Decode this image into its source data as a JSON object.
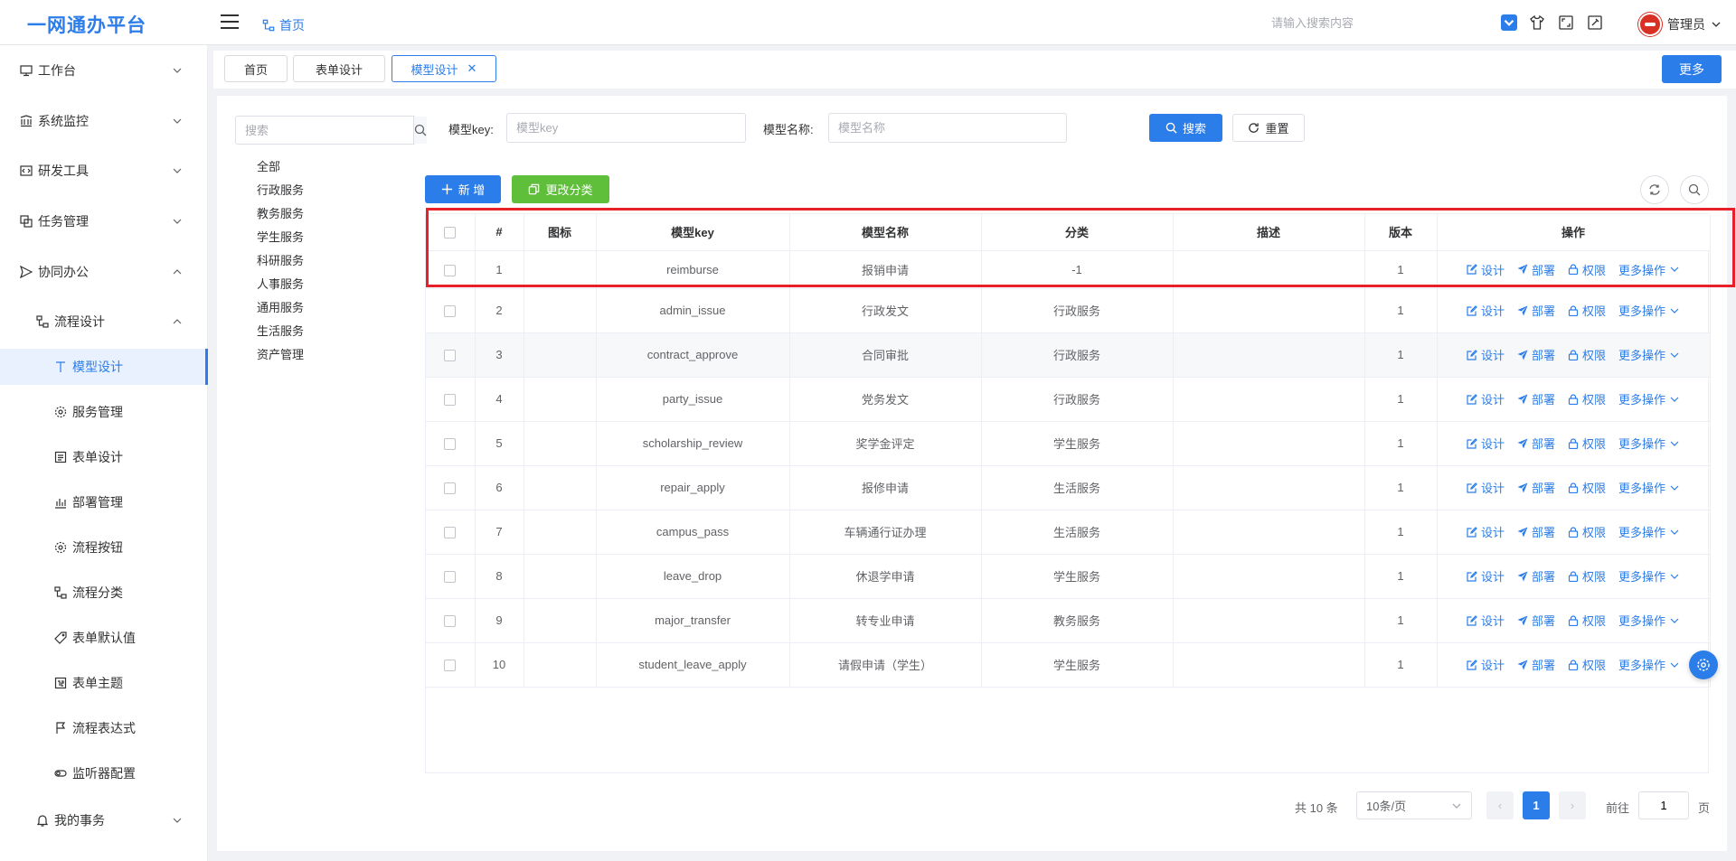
{
  "app": {
    "title": "一网通办平台"
  },
  "header": {
    "breadcrumb": "首页",
    "search_placeholder": "请输入搜索内容",
    "user_name": "管理员",
    "icons": [
      "checkbox-icon",
      "shirt-icon",
      "fullscreen-icon",
      "settings-tool-icon"
    ]
  },
  "sidebar": {
    "items": [
      {
        "label": "工作台",
        "icon": "monitor-icon",
        "level": 1,
        "expanded": false
      },
      {
        "label": "系统监控",
        "icon": "monitor-chart-icon",
        "level": 1,
        "expanded": false
      },
      {
        "label": "研发工具",
        "icon": "code-icon",
        "level": 1,
        "expanded": false
      },
      {
        "label": "任务管理",
        "icon": "task-icon",
        "level": 1,
        "expanded": false
      },
      {
        "label": "协同办公",
        "icon": "send-icon",
        "level": 1,
        "expanded": true
      },
      {
        "label": "流程设计",
        "icon": "flow-icon",
        "level": 2,
        "expanded": true
      },
      {
        "label": "模型设计",
        "icon": "model-icon",
        "level": 3,
        "active": true
      },
      {
        "label": "服务管理",
        "icon": "gear-icon",
        "level": 3
      },
      {
        "label": "表单设计",
        "icon": "form-icon",
        "level": 3
      },
      {
        "label": "部署管理",
        "icon": "bar-chart-icon",
        "level": 3
      },
      {
        "label": "流程按钮",
        "icon": "gear-icon",
        "level": 3
      },
      {
        "label": "流程分类",
        "icon": "flow-icon",
        "level": 3
      },
      {
        "label": "表单默认值",
        "icon": "tag-icon",
        "level": 3
      },
      {
        "label": "表单主题",
        "icon": "theme-icon",
        "level": 3
      },
      {
        "label": "流程表达式",
        "icon": "flag-icon",
        "level": 3
      },
      {
        "label": "监听器配置",
        "icon": "toggle-icon",
        "level": 3
      },
      {
        "label": "我的事务",
        "icon": "bell-icon",
        "level": 2,
        "expanded": false
      }
    ]
  },
  "tabs": [
    {
      "label": "首页"
    },
    {
      "label": "表单设计"
    },
    {
      "label": "模型设计",
      "active": true,
      "closable": true
    }
  ],
  "more_button": "更多",
  "tree": {
    "search_placeholder": "搜索",
    "categories": [
      "全部",
      "行政服务",
      "教务服务",
      "学生服务",
      "科研服务",
      "人事服务",
      "通用服务",
      "生活服务",
      "资产管理"
    ]
  },
  "filters": {
    "key_label": "模型key:",
    "key_placeholder": "模型key",
    "name_label": "模型名称:",
    "name_placeholder": "模型名称",
    "search_button": "搜索",
    "reset_button": "重置"
  },
  "toolbar": {
    "add_button": "新 增",
    "change_category_button": "更改分类"
  },
  "table": {
    "columns": [
      "#",
      "图标",
      "模型key",
      "模型名称",
      "分类",
      "描述",
      "版本",
      "操作"
    ],
    "op_labels": {
      "design": "设计",
      "deploy": "部署",
      "permission": "权限",
      "more": "更多操作"
    },
    "rows": [
      {
        "index": "1",
        "key": "reimburse",
        "name": "报销申请",
        "category": "-1",
        "desc": "",
        "version": "1"
      },
      {
        "index": "2",
        "key": "admin_issue",
        "name": "行政发文",
        "category": "行政服务",
        "desc": "",
        "version": "1"
      },
      {
        "index": "3",
        "key": "contract_approve",
        "name": "合同审批",
        "category": "行政服务",
        "desc": "",
        "version": "1"
      },
      {
        "index": "4",
        "key": "party_issue",
        "name": "党务发文",
        "category": "行政服务",
        "desc": "",
        "version": "1"
      },
      {
        "index": "5",
        "key": "scholarship_review",
        "name": "奖学金评定",
        "category": "学生服务",
        "desc": "",
        "version": "1"
      },
      {
        "index": "6",
        "key": "repair_apply",
        "name": "报修申请",
        "category": "生活服务",
        "desc": "",
        "version": "1"
      },
      {
        "index": "7",
        "key": "campus_pass",
        "name": "车辆通行证办理",
        "category": "生活服务",
        "desc": "",
        "version": "1"
      },
      {
        "index": "8",
        "key": "leave_drop",
        "name": "休退学申请",
        "category": "学生服务",
        "desc": "",
        "version": "1"
      },
      {
        "index": "9",
        "key": "major_transfer",
        "name": "转专业申请",
        "category": "教务服务",
        "desc": "",
        "version": "1"
      },
      {
        "index": "10",
        "key": "student_leave_apply",
        "name": "请假申请（学生）",
        "category": "学生服务",
        "desc": "",
        "version": "1"
      }
    ]
  },
  "pagination": {
    "total_text": "共 10 条",
    "page_size": "10条/页",
    "current_page": "1",
    "goto_prefix": "前往",
    "goto_value": "1",
    "goto_suffix": "页"
  },
  "colors": {
    "primary": "#2b7de9",
    "success": "#5fbf3a",
    "highlight": "#e8202a"
  }
}
